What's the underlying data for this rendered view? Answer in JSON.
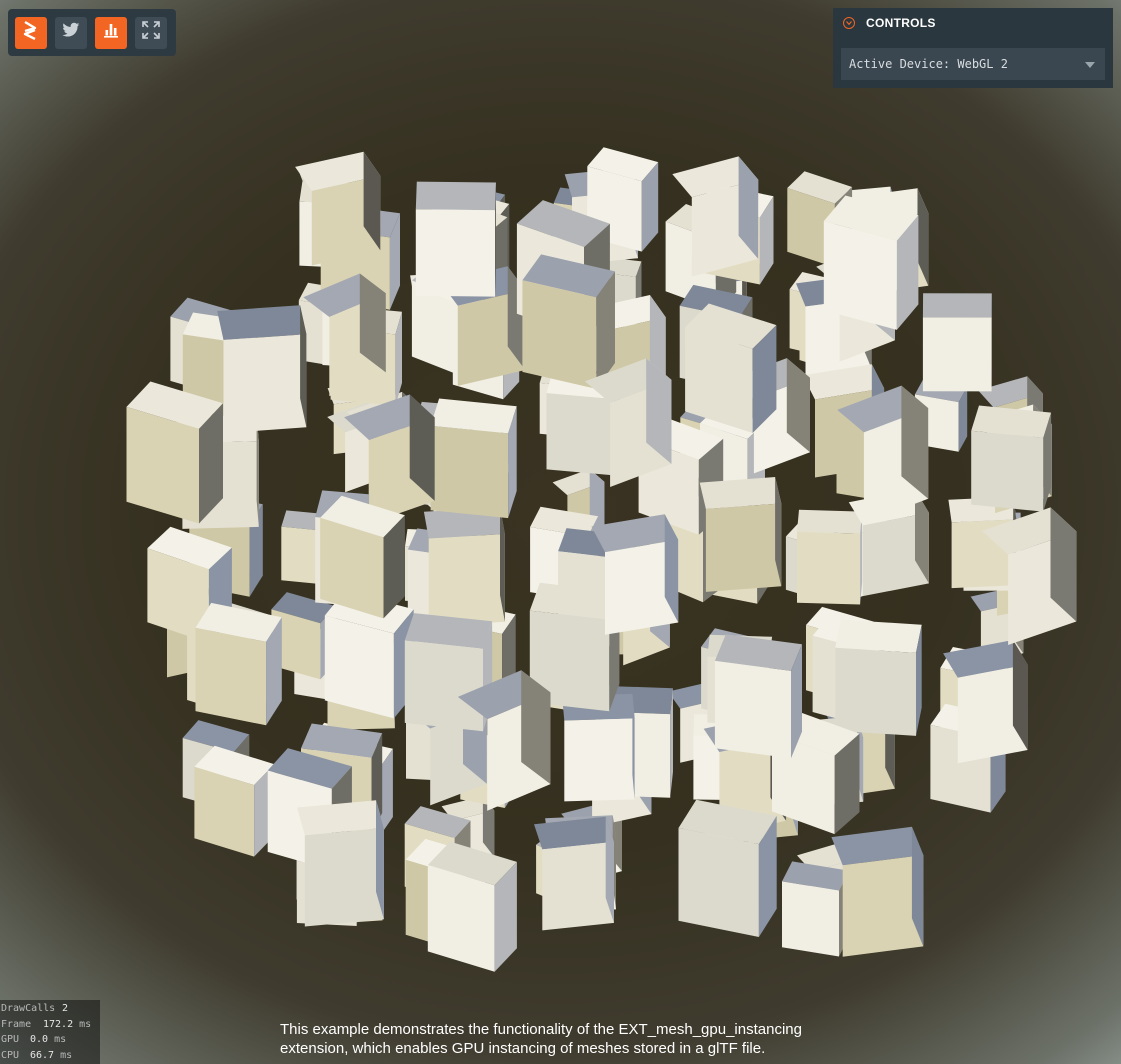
{
  "toolbar": {
    "buttons": [
      {
        "name": "app-logo-button",
        "icon": "luma-logo-icon",
        "active": true
      },
      {
        "name": "twitter-button",
        "icon": "twitter-icon",
        "active": false
      },
      {
        "name": "stats-button",
        "icon": "bar-chart-icon",
        "active": true
      },
      {
        "name": "fullscreen-button",
        "icon": "fullscreen-icon",
        "active": false
      }
    ]
  },
  "controls": {
    "title": "CONTROLS",
    "device_select_value": "Active Device: WebGL 2"
  },
  "stats": {
    "draw_calls": {
      "label": "DrawCalls",
      "value": "2",
      "unit": ""
    },
    "frame": {
      "label": "Frame",
      "value": "172.2",
      "unit": "ms"
    },
    "gpu": {
      "label": "GPU",
      "value": "0.0",
      "unit": "ms"
    },
    "cpu": {
      "label": "CPU",
      "value": "66.7",
      "unit": "ms"
    }
  },
  "caption": {
    "text": "This example demonstrates the functionality of the EXT_mesh_gpu_instancing extension, which enables GPU instancing of meshes stored in a glTF file."
  },
  "colors": {
    "accent": "#f26522",
    "panel": "#2b373f",
    "cube_face_light": "#eeebdf",
    "cube_face_blue": "#8a93a3",
    "cube_face_shadow": "#5d5c55"
  }
}
